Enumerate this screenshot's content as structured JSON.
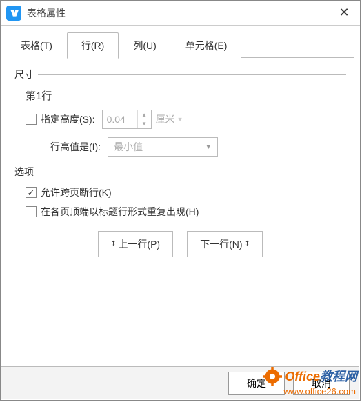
{
  "window": {
    "title": "表格属性"
  },
  "tabs": {
    "t0": "表格(T)",
    "t1": "行(R)",
    "t2": "列(U)",
    "t3": "单元格(E)"
  },
  "size": {
    "legend": "尺寸",
    "row_label": "第1行",
    "specify_height_label": "指定高度(S):",
    "height_value": "0.04",
    "unit": "厘米",
    "height_is_label": "行高值是(I):",
    "height_is_value": "最小值"
  },
  "options": {
    "legend": "选项",
    "allow_break_label": "允许跨页断行(K)",
    "allow_break_checked": true,
    "repeat_header_label": "在各页顶端以标题行形式重复出现(H)",
    "repeat_header_checked": false
  },
  "nav": {
    "prev": "上一行(P)",
    "next": "下一行(N)"
  },
  "buttons": {
    "ok": "确定",
    "cancel": "取消"
  },
  "watermark": {
    "line1a": "Office",
    "line1b": "教程网",
    "line2": "www.office26.com"
  }
}
